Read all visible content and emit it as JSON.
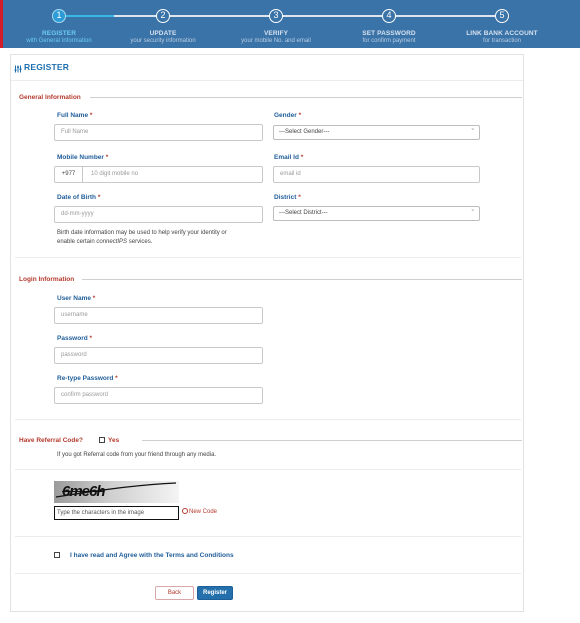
{
  "stepper": {
    "steps": [
      {
        "number": "1",
        "title": "REGISTER",
        "subtitle": "with General Information"
      },
      {
        "number": "2",
        "title": "UPDATE",
        "subtitle": "your security information"
      },
      {
        "number": "3",
        "title": "VERIFY",
        "subtitle": "your mobile No. and email"
      },
      {
        "number": "4",
        "title": "SET PASSWORD",
        "subtitle": "for confirm payment"
      },
      {
        "number": "5",
        "title": "LINK BANK ACCOUNT",
        "subtitle": "for transaction"
      }
    ],
    "active_step": 1
  },
  "form": {
    "title": "REGISTER",
    "general": {
      "section_title": "General Information",
      "full_name": {
        "label": "Full Name",
        "placeholder": "Full Name"
      },
      "gender": {
        "label": "Gender",
        "selected": "---Select Gender---"
      },
      "mobile": {
        "label": "Mobile Number",
        "prefix": "+977",
        "placeholder": "10 digit mobile no"
      },
      "email": {
        "label": "Email Id",
        "placeholder": "email id"
      },
      "dob": {
        "label": "Date of Birth",
        "placeholder": "dd-mm-yyyy"
      },
      "district": {
        "label": "District",
        "selected": "---Select District---"
      },
      "dob_help_line1": "Birth date information may be used to help verify your identity or",
      "dob_help_line2_prefix": "enable certain ",
      "dob_help_line2_italic": "connectIPS",
      "dob_help_line2_suffix": " services."
    },
    "login": {
      "section_title": "Login Information",
      "username": {
        "label": "User Name",
        "placeholder": "username"
      },
      "password": {
        "label": "Password",
        "placeholder": "password"
      },
      "retype": {
        "label": "Re-type Password",
        "placeholder": "confirm password"
      }
    },
    "referral": {
      "question": "Have Referral Code?",
      "yes_label": "Yes",
      "help": "If you got Referral code from your friend through any media."
    },
    "captcha": {
      "image_text": "6me6h",
      "input_placeholder": "Type the characters in the image",
      "new_code_label": "New Code"
    },
    "terms_label": "I have read and Agree with the Terms and Conditions",
    "buttons": {
      "back": "Back",
      "register": "Register"
    },
    "required_mark": "*"
  },
  "colors": {
    "stepper_bg": "#3a73a8",
    "active_step": "#2d9bd6",
    "section_title": "#b53a2e",
    "field_label": "#1f5d99",
    "primary_button": "#2470ad"
  }
}
